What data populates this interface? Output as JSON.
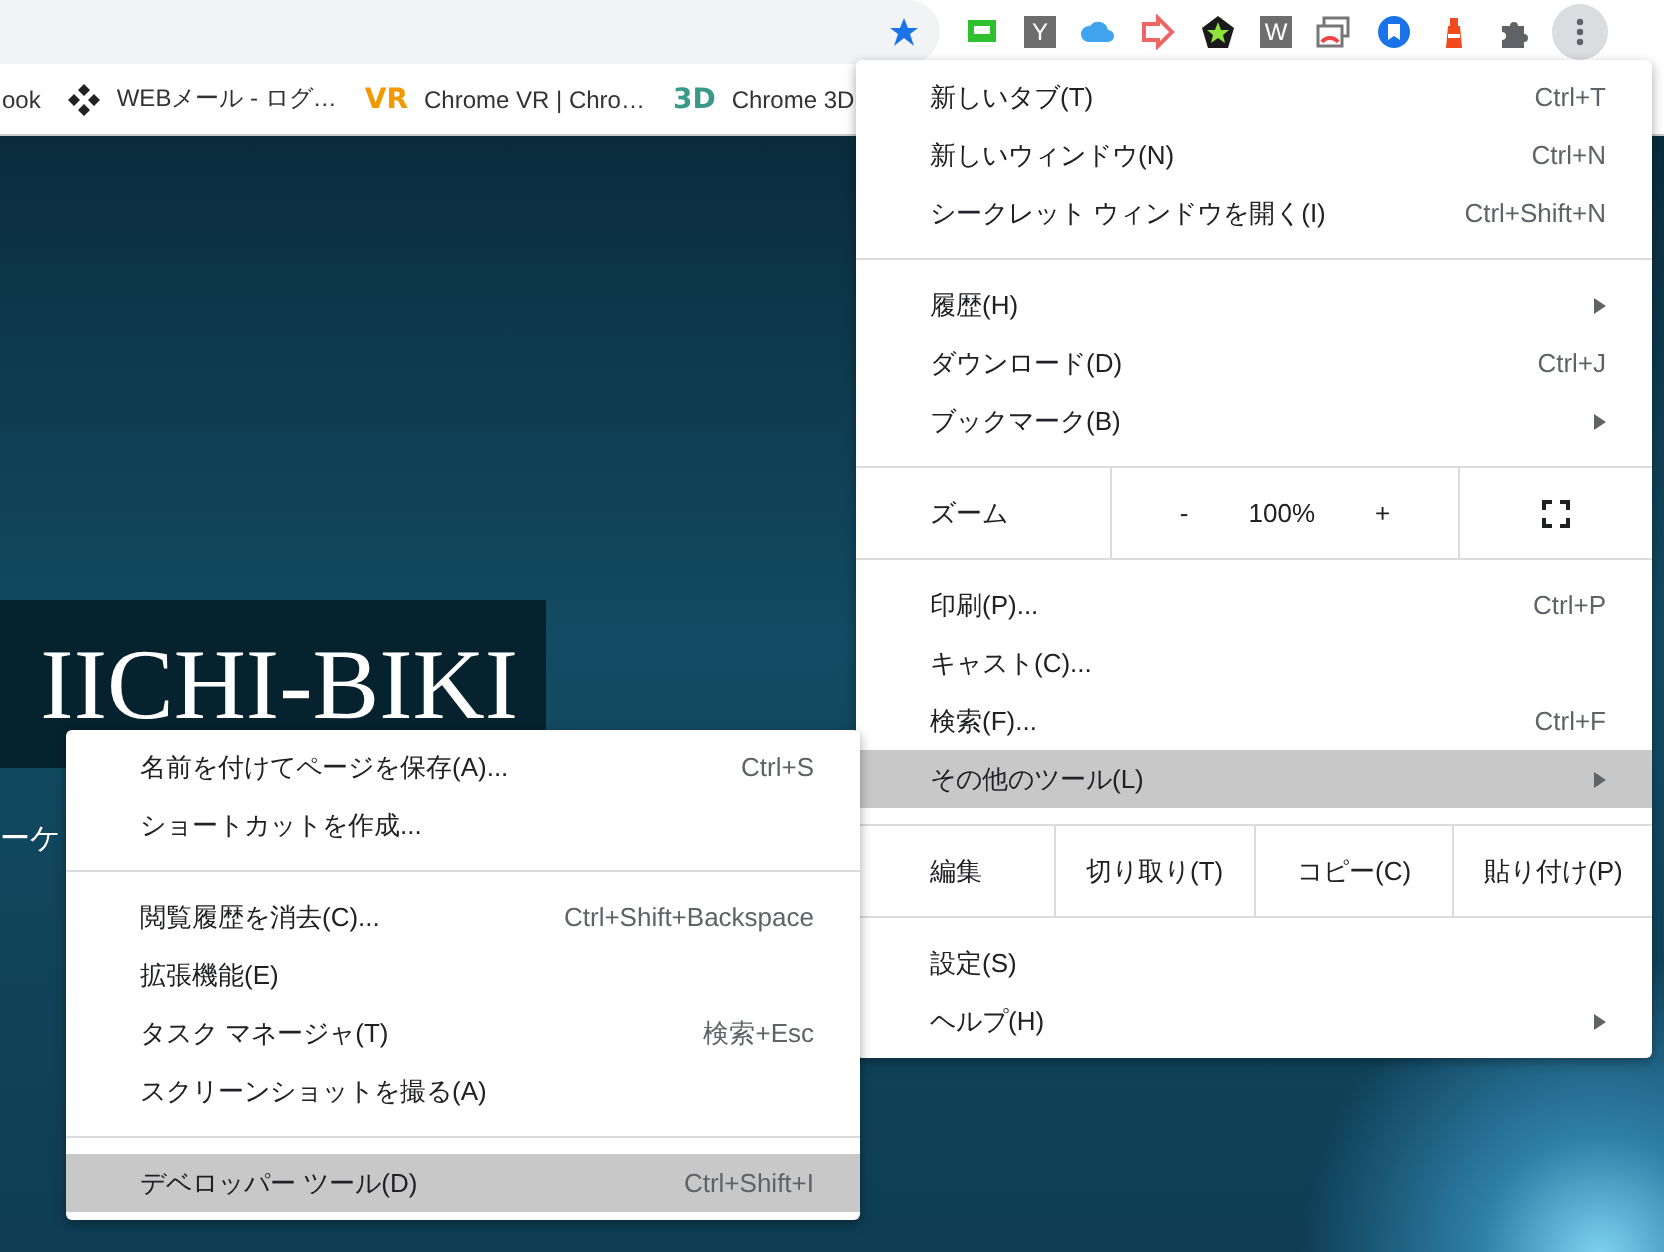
{
  "toolbar": {
    "extensions": [
      {
        "kind": "screen"
      },
      {
        "kind": "letter",
        "glyph": "Y"
      },
      {
        "kind": "cloud"
      },
      {
        "kind": "arrow"
      },
      {
        "kind": "pentagon"
      },
      {
        "kind": "letter",
        "glyph": "W"
      },
      {
        "kind": "cast"
      },
      {
        "kind": "bookmark"
      },
      {
        "kind": "lighthouse"
      },
      {
        "kind": "puzzle"
      }
    ],
    "bookmarked": true,
    "menu_open": true
  },
  "bookmarks": [
    {
      "kind": "none",
      "label": "ook"
    },
    {
      "kind": "diamonds",
      "label": "WEBメール - ログ…"
    },
    {
      "kind": "vr",
      "icon_text": "VR",
      "label": "Chrome VR | Chro…"
    },
    {
      "kind": "threed",
      "icon_text": "3D",
      "label": "Chrome 3D"
    }
  ],
  "page": {
    "title": "IICHI-BIKI",
    "subtitle": "ーケ"
  },
  "main_menu": {
    "sections": [
      [
        {
          "kind": "item",
          "label": "新しいタブ(T)",
          "shortcut": "Ctrl+T",
          "submenu": false,
          "selected": false
        },
        {
          "kind": "item",
          "label": "新しいウィンドウ(N)",
          "shortcut": "Ctrl+N",
          "submenu": false,
          "selected": false
        },
        {
          "kind": "item",
          "label": "シークレット ウィンドウを開く(I)",
          "shortcut": "Ctrl+Shift+N",
          "submenu": false,
          "selected": false
        }
      ],
      [
        {
          "kind": "item",
          "label": "履歴(H)",
          "submenu": true,
          "selected": false
        },
        {
          "kind": "item",
          "label": "ダウンロード(D)",
          "shortcut": "Ctrl+J",
          "submenu": false,
          "selected": false
        },
        {
          "kind": "item",
          "label": "ブックマーク(B)",
          "submenu": true,
          "selected": false
        }
      ],
      [
        {
          "kind": "zoom",
          "label": "ズーム",
          "minus": "-",
          "value": "100%",
          "plus": "+"
        }
      ],
      [
        {
          "kind": "item",
          "label": "印刷(P)...",
          "shortcut": "Ctrl+P",
          "submenu": false,
          "selected": false
        },
        {
          "kind": "item",
          "label": "キャスト(C)...",
          "submenu": false,
          "selected": false
        },
        {
          "kind": "item",
          "label": "検索(F)...",
          "shortcut": "Ctrl+F",
          "submenu": false,
          "selected": false
        },
        {
          "kind": "item",
          "label": "その他のツール(L)",
          "submenu": true,
          "selected": true
        }
      ],
      [
        {
          "kind": "edit",
          "label": "編集",
          "buttons": [
            "切り取り(T)",
            "コピー(C)",
            "貼り付け(P)"
          ]
        }
      ],
      [
        {
          "kind": "item",
          "label": "設定(S)",
          "submenu": false,
          "selected": false
        },
        {
          "kind": "item",
          "label": "ヘルプ(H)",
          "submenu": true,
          "selected": false
        }
      ]
    ]
  },
  "sub_menu": {
    "sections": [
      [
        {
          "kind": "item",
          "label": "名前を付けてページを保存(A)...",
          "shortcut": "Ctrl+S",
          "selected": false
        },
        {
          "kind": "item",
          "label": "ショートカットを作成...",
          "selected": false
        }
      ],
      [
        {
          "kind": "item",
          "label": "閲覧履歴を消去(C)...",
          "shortcut": "Ctrl+Shift+Backspace",
          "selected": false
        },
        {
          "kind": "item",
          "label": "拡張機能(E)",
          "selected": false
        },
        {
          "kind": "item",
          "label": "タスク マネージャ(T)",
          "shortcut": "検索+Esc",
          "selected": false
        },
        {
          "kind": "item",
          "label": "スクリーンショットを撮る(A)",
          "selected": false
        }
      ],
      [
        {
          "kind": "item",
          "label": "デベロッパー ツール(D)",
          "shortcut": "Ctrl+Shift+I",
          "selected": true
        }
      ]
    ]
  }
}
